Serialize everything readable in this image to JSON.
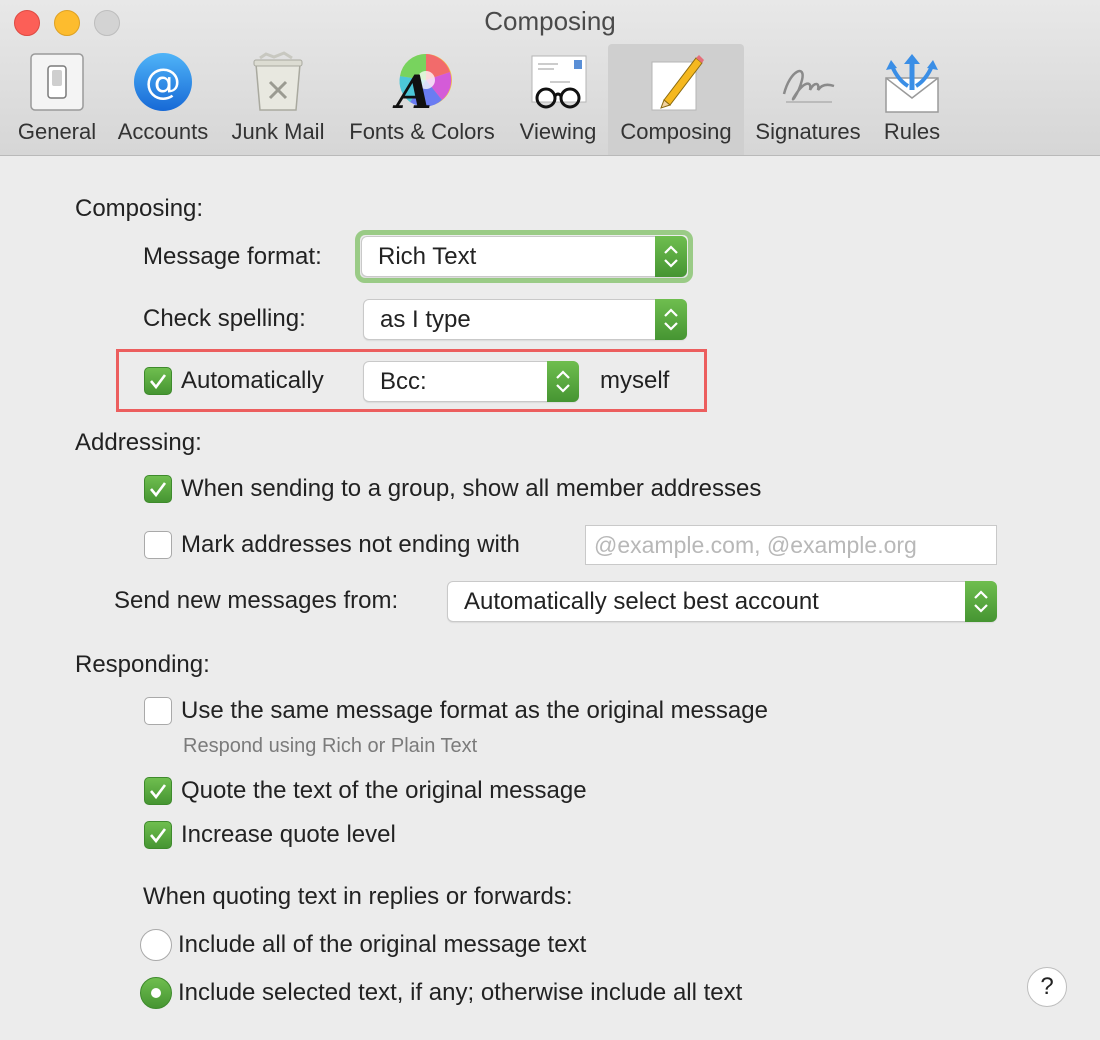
{
  "window": {
    "title": "Composing"
  },
  "toolbar": {
    "tabs": [
      {
        "label": "General",
        "icon": "switch-icon"
      },
      {
        "label": "Accounts",
        "icon": "at-sign-icon"
      },
      {
        "label": "Junk Mail",
        "icon": "trash-can-icon"
      },
      {
        "label": "Fonts & Colors",
        "icon": "font-color-wheel-icon"
      },
      {
        "label": "Viewing",
        "icon": "glasses-icon"
      },
      {
        "label": "Composing",
        "icon": "pencil-paper-icon",
        "selected": true
      },
      {
        "label": "Signatures",
        "icon": "signature-icon"
      },
      {
        "label": "Rules",
        "icon": "envelope-arrows-icon"
      }
    ]
  },
  "composing": {
    "heading": "Composing:",
    "message_format_label": "Message format:",
    "message_format_value": "Rich Text",
    "check_spelling_label": "Check spelling:",
    "check_spelling_value": "as I type",
    "auto_label": "Automatically",
    "auto_checked": true,
    "auto_value": "Bcc:",
    "auto_suffix": "myself"
  },
  "addressing": {
    "heading": "Addressing:",
    "group_label": "When sending to a group, show all member addresses",
    "group_checked": true,
    "mark_label": "Mark addresses not ending with",
    "mark_checked": false,
    "mark_placeholder": "@example.com, @example.org",
    "send_from_label": "Send new messages from:",
    "send_from_value": "Automatically select best account"
  },
  "responding": {
    "heading": "Responding:",
    "same_format_label": "Use the same message format as the original message",
    "same_format_checked": false,
    "same_format_hint": "Respond using Rich or Plain Text",
    "quote_label": "Quote the text of the original message",
    "quote_checked": true,
    "increase_label": "Increase quote level",
    "increase_checked": true,
    "quoting_heading": "When quoting text in replies or forwards:",
    "include_all_label": "Include all of the original message text",
    "include_selected_label": "Include selected text, if any; otherwise include all text",
    "selected_option": "include_selected"
  },
  "help": {
    "label": "?"
  },
  "colors": {
    "accent_green": "#56a83c",
    "highlight_red": "#ec5e5e"
  }
}
